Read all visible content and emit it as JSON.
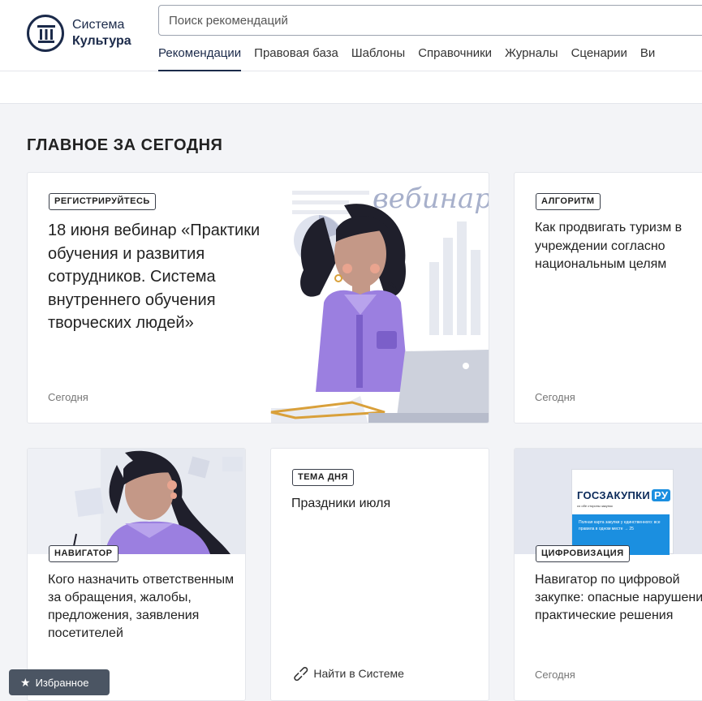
{
  "logo": {
    "line1": "Система",
    "line2": "Культура"
  },
  "search": {
    "placeholder": "Поиск рекомендаций"
  },
  "nav": [
    {
      "label": "Рекомендации",
      "active": true
    },
    {
      "label": "Правовая база"
    },
    {
      "label": "Шаблоны"
    },
    {
      "label": "Справочники"
    },
    {
      "label": "Журналы"
    },
    {
      "label": "Сценарии"
    },
    {
      "label": "Ви"
    }
  ],
  "section_title": "ГЛАВНОЕ ЗА СЕГОДНЯ",
  "cards": {
    "webinar": {
      "tag": "РЕГИСТРИРУЙТЕСЬ",
      "title": "18 июня вебинар «Практики обучения и развития сотрудников. Система внутреннего обучения творческих людей»",
      "date": "Сегодня",
      "illustration_word": "вебинар"
    },
    "algorithm": {
      "tag": "АЛГОРИТМ",
      "title": "Как продвигать туризм в учреждении согласно национальным целям",
      "date": "Сегодня"
    },
    "navigator": {
      "tag": "НАВИГАТОР",
      "title": "Кого назначить ответственным за обращения, жалобы, предложения, заявления посетителей"
    },
    "theme": {
      "tag": "ТЕМА ДНЯ",
      "title": "Праздники июля",
      "link": "Найти в Системе"
    },
    "digital": {
      "tag": "ЦИФРОВИЗАЦИЯ",
      "title": "Навигатор по цифровой закупке: опасные нарушения и практические решения",
      "date": "Сегодня",
      "magazine_title": "ГОСЗАКУПКИ",
      "magazine_badge": "РУ",
      "magazine_sub": "со обе стороны закупок",
      "magazine_blurb": "Полная карта закупки у единственного: все правила в одном месте → 25"
    }
  },
  "favorites": {
    "label": "Избранное"
  },
  "colors": {
    "brand": "#1b2a4a",
    "purple": "#9b7fe0",
    "muted": "#777777"
  }
}
